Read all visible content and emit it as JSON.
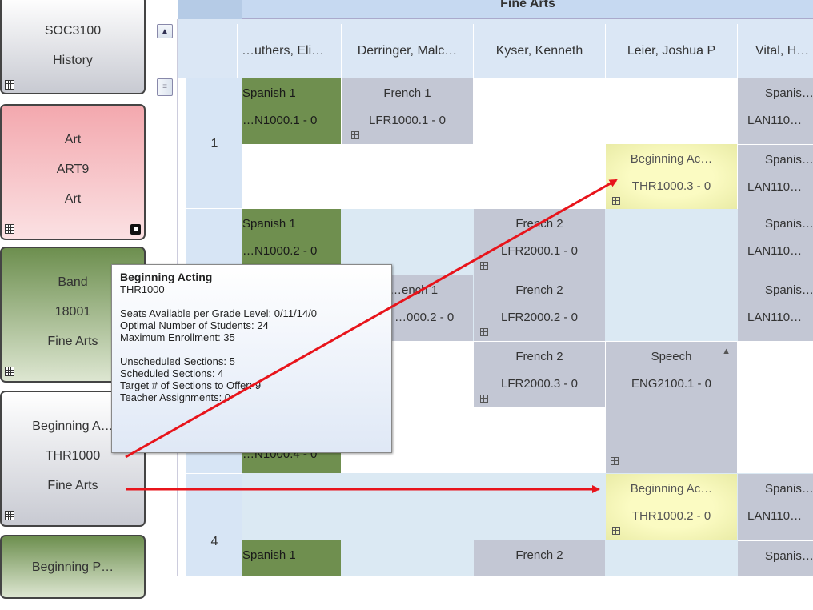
{
  "header": {
    "group_title": "Fine Arts"
  },
  "teachers": [
    "…uthers, Eli…",
    "Derringer, Malc…",
    "Kyser, Kenneth",
    "Leier, Joshua P",
    "Vital, H…"
  ],
  "periods": [
    "1",
    "4"
  ],
  "courses": [
    {
      "line1": "SOC3100",
      "line2": "History"
    },
    {
      "line1": "Art",
      "line2": "ART9",
      "line3": "Art"
    },
    {
      "line1": "Band",
      "line2": "18001",
      "line3": "Fine Arts"
    },
    {
      "line1": "Beginning A…",
      "line2": "THR1000",
      "line3": "Fine Arts"
    },
    {
      "line1": "Beginning P…"
    }
  ],
  "cells": {
    "spanish1": "Spanish 1",
    "french1": "French 1",
    "french2": "French 2",
    "spanish": "Spanis…",
    "speech": "Speech",
    "beg_acting": "Beginning Ac…",
    "frag_ench1": "…ench 1",
    "lan1000_1": "…N1000.1 - 0",
    "lan1000_2": "…N1000.2 - 0",
    "lan1000_4": "…N1000.4 - 0",
    "lfr1000_1": "LFR1000.1 - 0",
    "lfr1000_2": "…000.2 - 0",
    "lfr2000_1": "LFR2000.1 - 0",
    "lfr2000_2": "LFR2000.2 - 0",
    "lfr2000_3": "LFR2000.3 - 0",
    "thr1000_3": "THR1000.3 - 0",
    "thr1000_2": "THR1000.2 - 0",
    "eng2100_1": "ENG2100.1 - 0",
    "lan1100": "LAN110…"
  },
  "tooltip": {
    "title": "Beginning Acting",
    "code": "THR1000",
    "seats": "Seats Available per Grade Level: 0/11/14/0",
    "optimal": "Optimal Number of Students: 24",
    "max": "Maximum Enrollment: 35",
    "unscheduled": "Unscheduled Sections: 5",
    "scheduled": "Scheduled Sections: 4",
    "target": "Target # of Sections to Offer: 9",
    "teacher": "Teacher Assignments: 0"
  },
  "colors": {
    "arrow": "#e8141b",
    "header": "#c6d9f1",
    "period_bg": "#d7e5f5"
  }
}
